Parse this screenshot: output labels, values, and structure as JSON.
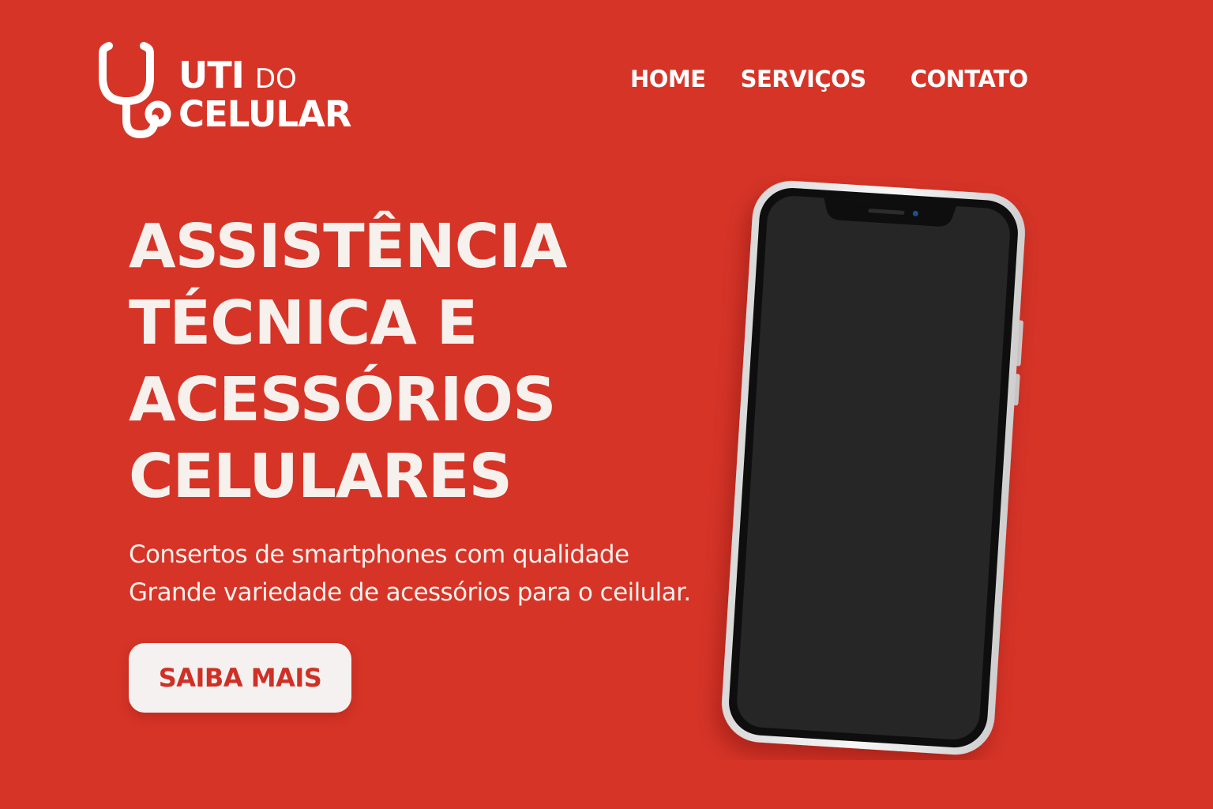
{
  "brand": {
    "uti": "UTI",
    "do": "DO",
    "celular": "CELULAR",
    "logo_icon": "stethoscope-icon"
  },
  "nav": {
    "items": [
      {
        "label": "HOME"
      },
      {
        "label": "SERVIÇOS"
      },
      {
        "label": "CONTATO"
      }
    ]
  },
  "hero": {
    "title_lines": [
      "ASSISTÊNCIA",
      "TÉCNICA E",
      "ACESSÓRIOS",
      "CELULARES"
    ],
    "description_lines": [
      "Consertos de smartphones com qualidade",
      "Grande variedade de acessórios para o ceilular."
    ],
    "cta_label": "SAIBA MAIS"
  },
  "colors": {
    "background": "#d63427",
    "text": "#ffffff",
    "button_bg": "#f4f1f0",
    "button_text": "#cf3025",
    "phone_frame": "#f0f0f0",
    "phone_screen": "#262626"
  }
}
